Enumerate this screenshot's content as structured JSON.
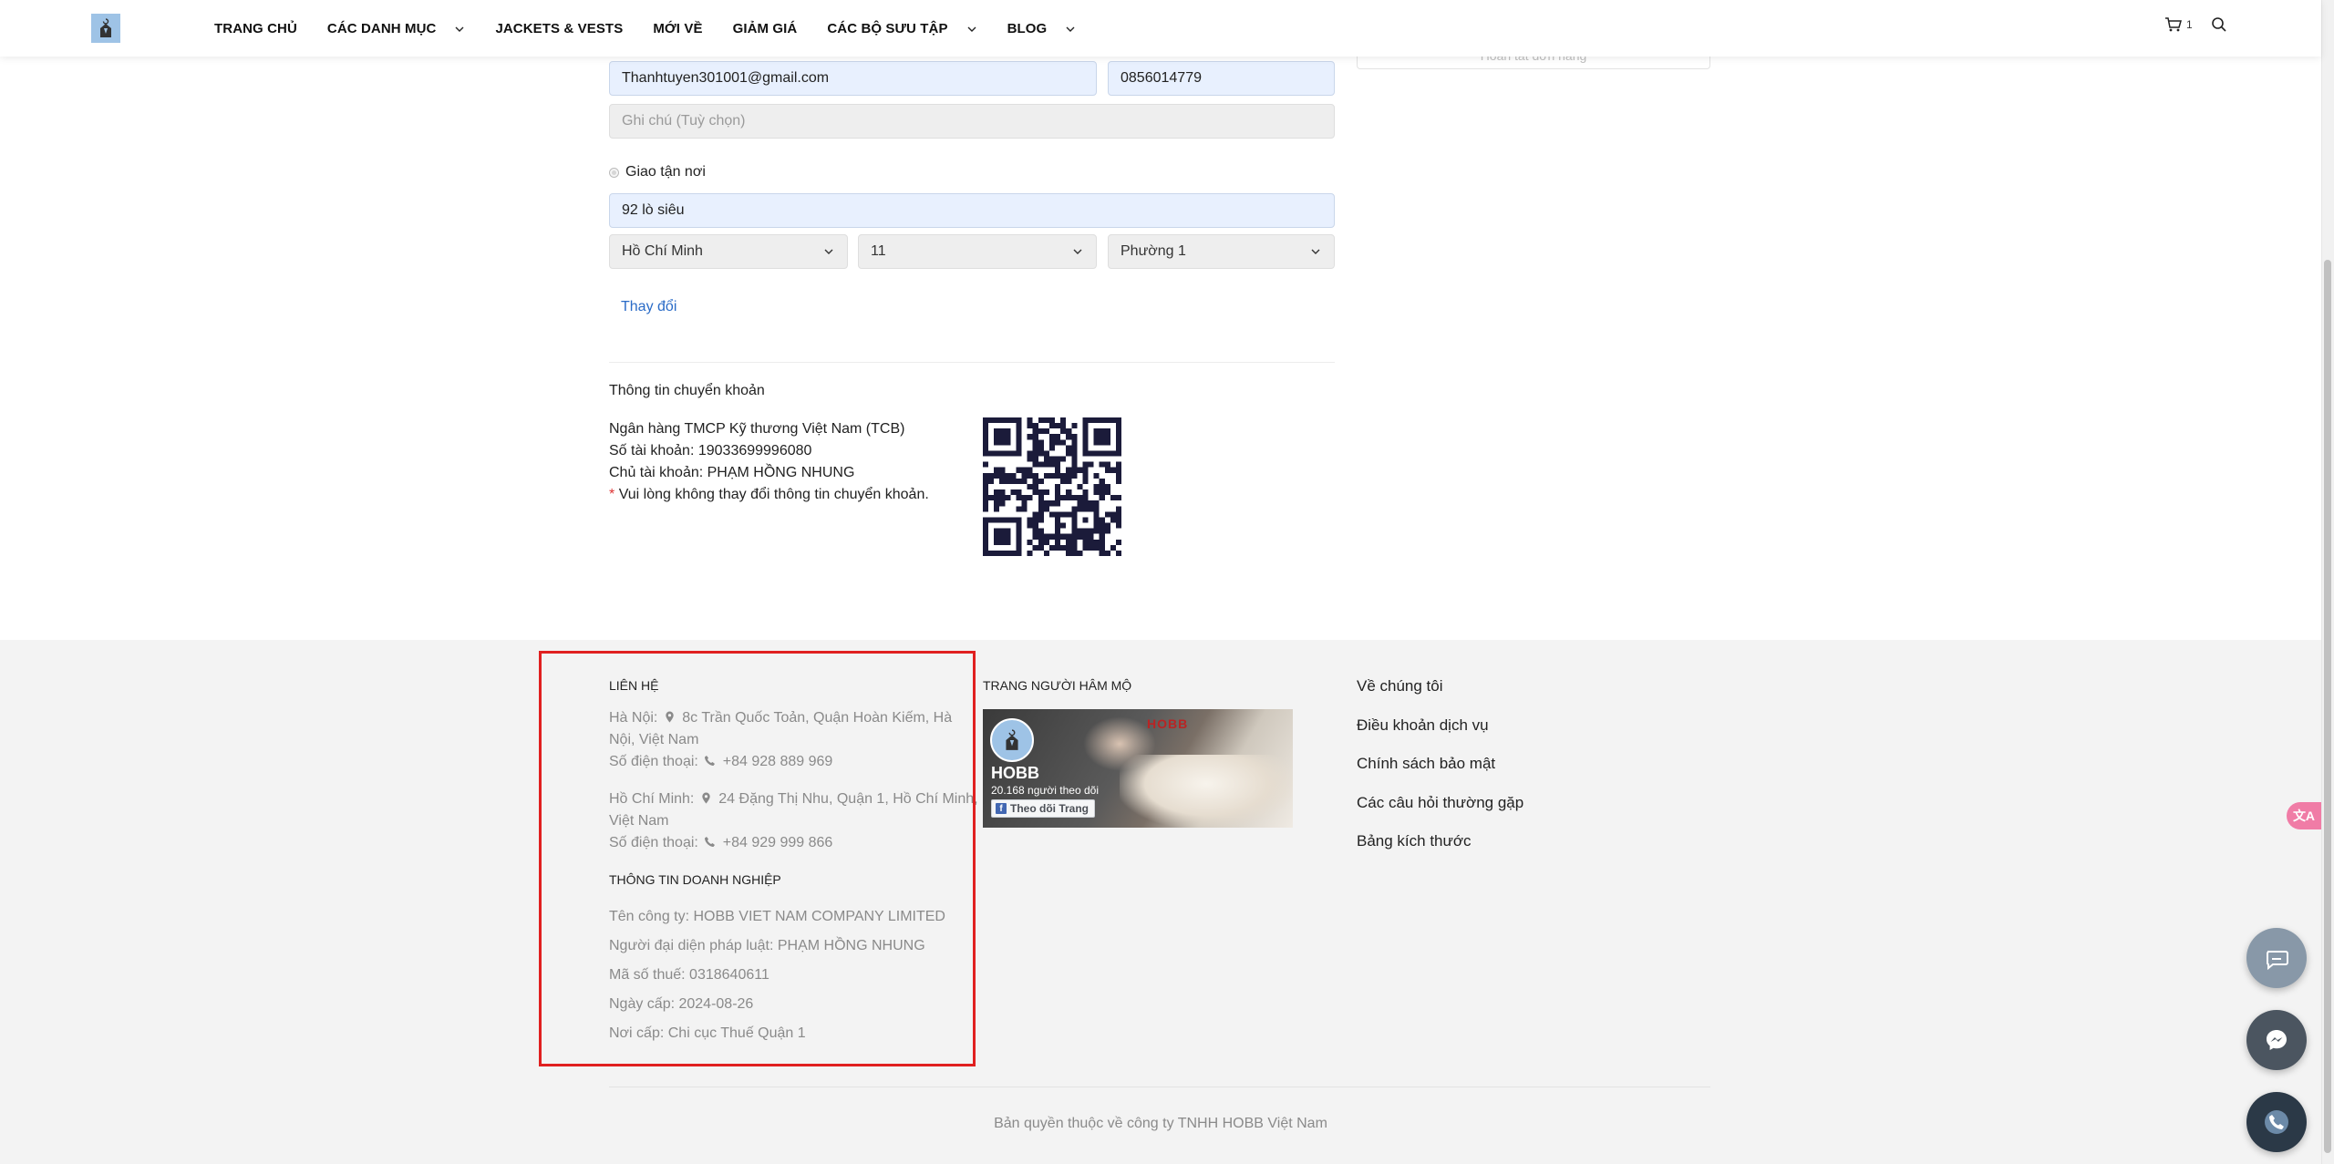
{
  "header": {
    "nav": [
      {
        "label": "TRANG CHỦ",
        "dropdown": false
      },
      {
        "label": "CÁC DANH MỤC",
        "dropdown": true
      },
      {
        "label": "JACKETS & VESTS",
        "dropdown": false
      },
      {
        "label": "MỚI VỀ",
        "dropdown": false
      },
      {
        "label": "GIẢM GIÁ",
        "dropdown": false
      },
      {
        "label": "CÁC BỘ SƯU TẬP",
        "dropdown": true
      },
      {
        "label": "BLOG",
        "dropdown": true
      }
    ],
    "cart_count": "1"
  },
  "form": {
    "email_value": "Thanhtuyen301001@gmail.com",
    "phone_value": "0856014779",
    "note_placeholder": "Ghi chú (Tuỳ chọn)",
    "delivery_label": "Giao tận nơi",
    "address_value": "92 lò siêu",
    "province": "Hồ Chí Minh",
    "district": "11",
    "ward": "Phường 1",
    "change_link": "Thay đổi"
  },
  "summary_box_text": "Hoàn tất đơn hàng",
  "bank": {
    "title": "Thông tin chuyển khoản",
    "bank_name": "Ngân hàng TMCP Kỹ thương Việt Nam (TCB)",
    "account_number": "Số tài khoản: 19033699996080",
    "account_holder": "Chủ tài khoản: PHẠM HỒNG NHUNG",
    "warning_star": "*",
    "warning": "Vui lòng không thay đổi thông tin chuyển khoản."
  },
  "footer": {
    "contact": {
      "title": "LIÊN HỆ",
      "hanoi_prefix": "Hà Nội:",
      "hanoi_address": "8c Trần Quốc Toản, Quận Hoàn Kiếm, Hà",
      "hanoi_address_2": "Nội, Việt Nam",
      "hanoi_phone_prefix": "Số điện thoại:",
      "hanoi_phone": "+84 928 889 969",
      "hcm_prefix": "Hồ Chí Minh:",
      "hcm_address": "24 Đặng Thị Nhu, Quận 1, Hồ Chí Minh,",
      "hcm_address_2": "Việt Nam",
      "hcm_phone_prefix": "Số điện thoại:",
      "hcm_phone": "+84 929 999 866"
    },
    "business": {
      "title": "THÔNG TIN DOANH NGHIỆP",
      "company": "Tên công ty: HOBB VIET NAM COMPANY LIMITED",
      "representative": "Người đại diện pháp luật: PHẠM HỒNG NHUNG",
      "tax_code": "Mã số thuế: 0318640611",
      "issue_date": "Ngày cấp: 2024-08-26",
      "issue_place": "Nơi cấp: Chi cục Thuế Quận 1"
    },
    "fanpage": {
      "title": "TRANG NGƯỜI HÂM MỘ",
      "page_name": "HOBB",
      "followers": "20.168 người theo dõi",
      "follow_button": "Theo dõi Trang",
      "banner_text": "HOBB"
    },
    "links": [
      "Về chúng tôi",
      "Điều khoản dịch vụ",
      "Chính sách bảo mật",
      "Các câu hỏi thường gặp",
      "Bảng kích thước"
    ],
    "copyright": "Bản quyền thuộc về công ty TNHH HOBB Việt Nam"
  },
  "floating": {
    "translate_label": "文A"
  },
  "colors": {
    "highlight_border": "#e02020",
    "link_blue": "#2a6bc7",
    "footer_bg": "#f3f3f3",
    "field_blue": "#e8f0fe"
  }
}
